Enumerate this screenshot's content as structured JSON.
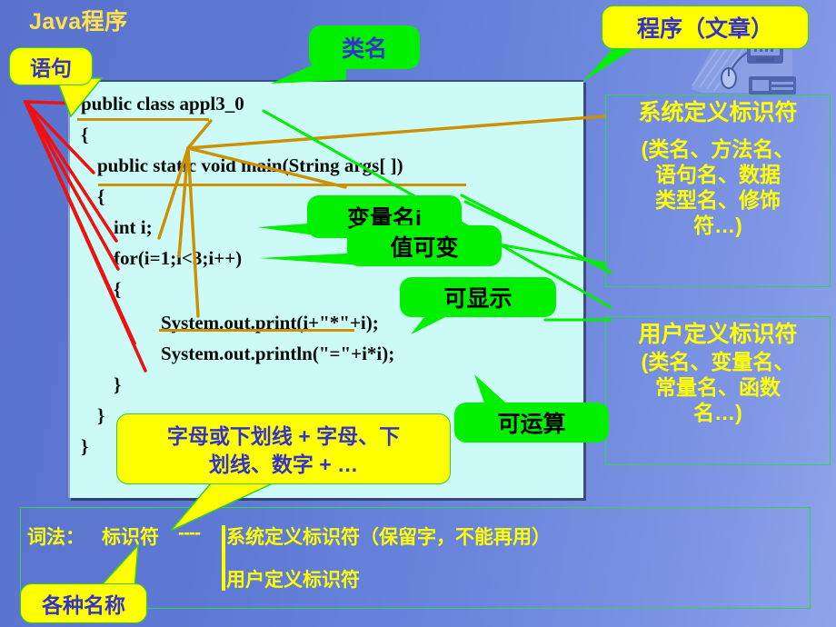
{
  "slide": {
    "title": "Java程序",
    "background_start": "#5a72ce",
    "background_end": "#8ea4e9"
  },
  "code_panel": {
    "background": "#ccfaf6",
    "underline_color": "#cc9000",
    "lines": [
      "public class appl3_0",
      "{",
      "public static void main(String args[ ])",
      "{",
      "int i;",
      "for(i=1;i<3;i++)",
      "{",
      "System.out.print(i+\"*\"+i);",
      "System.out.println(\"=\"+i*i);",
      "}",
      "}",
      "}"
    ]
  },
  "callouts": {
    "statement": {
      "label": "语句",
      "fill": "#ffff00",
      "text_color": "#3333cc"
    },
    "class_name": {
      "label": "类名",
      "fill": "#00f000",
      "text_color": "#3333cc"
    },
    "program_article": {
      "label": "程序（文章）",
      "fill": "#ffff00",
      "text_color": "#3333cc"
    },
    "variable_name": {
      "label": "变量名i",
      "fill": "#00f000",
      "text_color": "#000000"
    },
    "value_changeable": {
      "label": "值可变",
      "fill": "#00f000",
      "text_color": "#000000"
    },
    "displayable": {
      "label": "可显示",
      "fill": "#00f000",
      "text_color": "#000000"
    },
    "computable": {
      "label": "可运算",
      "fill": "#00f000",
      "text_color": "#000000"
    },
    "identifier_rule_line1": "字母或下划线 + 字母、下",
    "identifier_rule_line2": "划线、数字 +  …",
    "various_names": {
      "label": "各种名称",
      "fill": "#ffff00",
      "text_color": "#3333cc"
    }
  },
  "panels": {
    "system_defined": {
      "heading": "系统定义标识符",
      "body_lines": [
        "(类名、方法名、",
        "语句名、数据",
        "类型名、修饰",
        "符…)"
      ],
      "border": "#2fd44f",
      "text_color": "#ffff00"
    },
    "user_defined": {
      "heading": "用户定义标识符",
      "body_lines": [
        "(类名、变量名、",
        "常量名、函数",
        "名…)"
      ],
      "border": "#2fd44f",
      "text_color": "#ffff00"
    }
  },
  "legend": {
    "prefix": "词法：",
    "term": "标识符",
    "dashes": "----",
    "row1": "系统定义标识符（保留字，不能再用）",
    "row2": "用户定义标识符",
    "border": "#2fd44f",
    "text_color": "#ffff00"
  }
}
